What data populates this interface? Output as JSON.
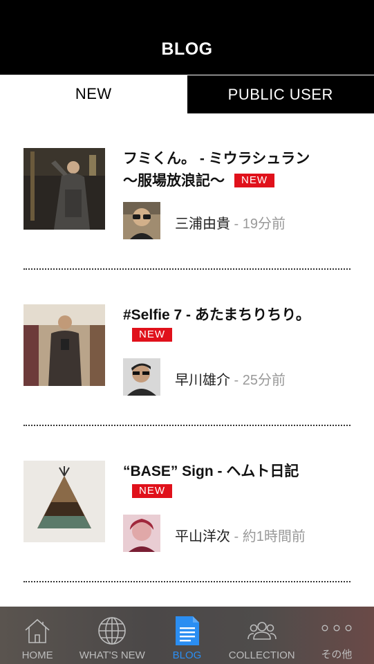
{
  "nav": {
    "title": "BLOG"
  },
  "tabs": [
    {
      "label": "NEW"
    },
    {
      "label": "PUBLIC USER"
    }
  ],
  "posts": [
    {
      "title": "フミくん。 - ミウラシュラン〜服場放浪記〜",
      "title_line1": "フミくん。 - ミウラシュラン",
      "title_line2": "〜服場放浪記〜",
      "badge": "NEW",
      "author": "三浦由貴",
      "separator": " - ",
      "time_ago": "19分前"
    },
    {
      "title": "#Selfie 7 - あたまちりちり。",
      "badge": "NEW",
      "author": "早川雄介",
      "separator": " - ",
      "time_ago": "25分前"
    },
    {
      "title": "“BASE” Sign - ヘムト日記",
      "badge": "NEW",
      "author": "平山洋次",
      "separator": " - ",
      "time_ago": "約1時間前"
    }
  ],
  "tabbar": {
    "items": [
      {
        "label": "HOME",
        "icon": "home-icon"
      },
      {
        "label": "WHAT'S NEW",
        "icon": "globe-icon"
      },
      {
        "label": "BLOG",
        "icon": "document-icon",
        "active": true
      },
      {
        "label": "COLLECTION",
        "icon": "people-icon"
      },
      {
        "label": "その他",
        "icon": "more-dots-icon"
      }
    ],
    "active_color": "#2b8ef2",
    "inactive_color": "#bdbdbd"
  },
  "colors": {
    "badge": "#e0111b",
    "header": "#000000"
  }
}
